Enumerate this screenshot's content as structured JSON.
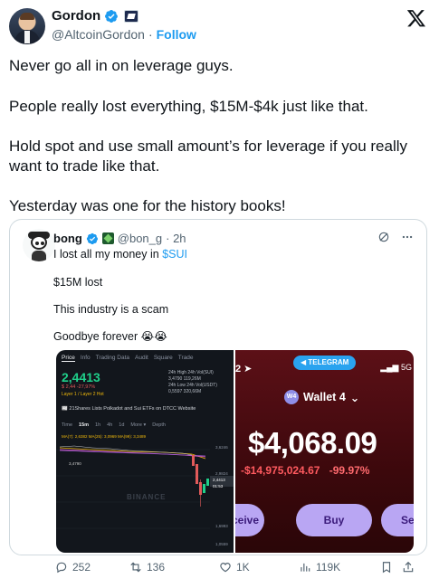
{
  "author": {
    "name": "Gordon",
    "handle": "@AltcoinGordon",
    "separator": "·",
    "follow_label": "Follow"
  },
  "body": {
    "paragraphs": [
      "Never go all in on leverage guys.",
      "People really lost everything, $15M-$4k just like that.",
      "Hold spot and use small amount’s for leverage if you really want to trade like that.",
      "Yesterday was one for the history books!"
    ]
  },
  "quote": {
    "name": "bong",
    "handle": "@bon_g",
    "time": "· 2h",
    "line1_prefix": "I lost all my money in ",
    "line1_link": "$SUI",
    "line2": "$15M lost",
    "line3": "This industry is a scam",
    "line4": "Goodbye forever 😭😭",
    "screenshot_left": {
      "tabs": [
        "Price",
        "Info",
        "Trading Data",
        "Audit",
        "Square",
        "Trade"
      ],
      "price": "2,4413",
      "sub": "$ 2,44  -27,97%",
      "sub2": "Layer 1 / Layer 2   Hot",
      "stats": [
        "24h High   24h Vol(SUI)",
        "3,4790        119,26M",
        "24h Low    24h Vol(USDT)",
        "0,5597        320,66M"
      ],
      "news": "21Shares Lists Polkadot and Sui ETFs on DTCC Website",
      "timeframes": [
        "Time",
        "15m",
        "1h",
        "4h",
        "1d",
        "More ▾",
        "Depth"
      ],
      "ma_line": "MA(7): 2,6382   MA(25): 3,0969   MA(99): 3,3489",
      "axis_labels": [
        "3,6246",
        "2,9824",
        "2,4413",
        "01:53",
        "1,6993",
        "1,0559"
      ],
      "top_label": "3,4790",
      "watermark": "BINANCE"
    },
    "screenshot_right": {
      "time": "2",
      "telegram_label": "TELEGRAM",
      "signal": "5G",
      "wallet_badge": "W4",
      "wallet_name": "Wallet 4",
      "balance": "$4,068.09",
      "delta": "-$14,975,024.67",
      "delta_pct": "-99.97%",
      "btn_receive": "ceive",
      "btn_buy": "Buy",
      "btn_send": "Ser"
    }
  },
  "actions": {
    "replies": "252",
    "reposts": "136",
    "likes": "1K",
    "views": "119K"
  },
  "colors": {
    "accent": "#1d9bf0",
    "text": "#0f1419",
    "muted": "#536471",
    "price_green": "#1fcf8a",
    "loss_red": "#ff5a5f"
  }
}
